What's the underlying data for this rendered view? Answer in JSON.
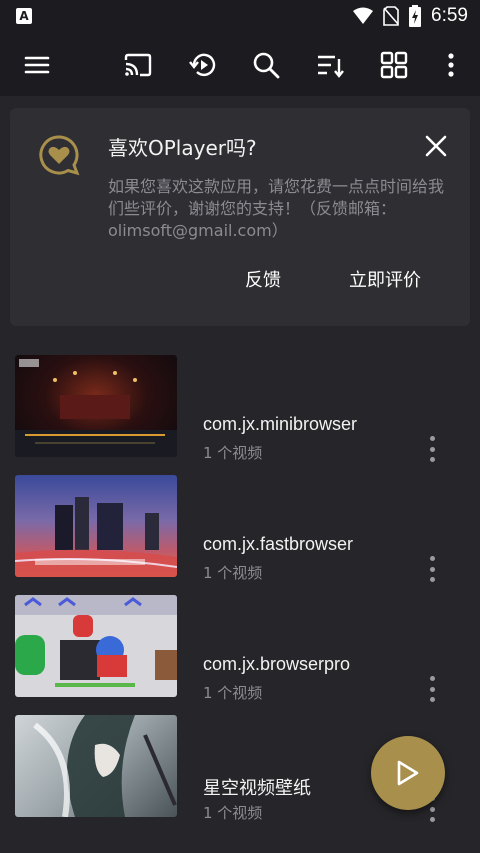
{
  "status_bar": {
    "time": "6:59"
  },
  "toolbar": {
    "icons": [
      "menu-icon",
      "cast-icon",
      "history-icon",
      "search-icon",
      "sort-icon",
      "grid-icon",
      "more-vertical-icon"
    ]
  },
  "rating_card": {
    "title": "喜欢OPlayer吗?",
    "body": "如果您喜欢这款应用，请您花费一点点时间给我们些评价，谢谢您的支持！（反馈邮箱：olimsoft@gmail.com）",
    "feedback_label": "反馈",
    "rate_label": "立即评价"
  },
  "folders": [
    {
      "name": "com.jx.minibrowser",
      "count": "1 个视频"
    },
    {
      "name": "com.jx.fastbrowser",
      "count": "1 个视频"
    },
    {
      "name": "com.jx.browserpro",
      "count": "1 个视频"
    },
    {
      "name": "星空视频壁纸",
      "count": "1 个视频"
    }
  ],
  "colors": {
    "accent": "#a8904c",
    "background": "#26262a",
    "card": "#2e2e33"
  }
}
